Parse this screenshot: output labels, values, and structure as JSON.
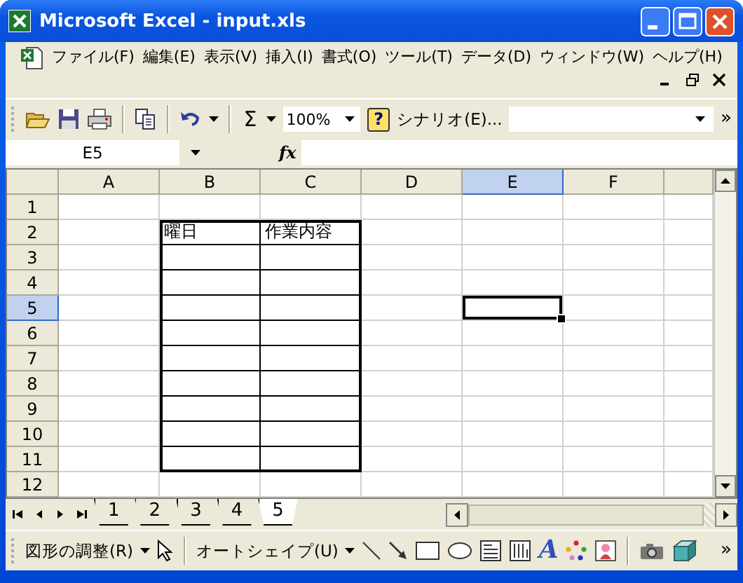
{
  "window": {
    "title": "Microsoft Excel - input.xls"
  },
  "menu": [
    "ファイル(F)",
    "編集(E)",
    "表示(V)",
    "挿入(I)",
    "書式(O)",
    "ツール(T)",
    "データ(D)",
    "ウィンドウ(W)",
    "ヘルプ(H)"
  ],
  "toolbar": {
    "sum": "Σ",
    "zoom": "100%",
    "help_glyph": "?",
    "scenario": "シナリオ(E)...",
    "overflow": "»"
  },
  "formula_bar": {
    "name_box": "E5",
    "fx": "fx"
  },
  "grid": {
    "columns": [
      {
        "label": "A",
        "selected": false
      },
      {
        "label": "B",
        "selected": false
      },
      {
        "label": "C",
        "selected": false
      },
      {
        "label": "D",
        "selected": false
      },
      {
        "label": "E",
        "selected": true
      },
      {
        "label": "F",
        "selected": false
      }
    ],
    "rows": [
      {
        "label": "1",
        "selected": false
      },
      {
        "label": "2",
        "selected": false,
        "cells": [
          {
            "bordered": false,
            "selected": false
          },
          {
            "bordered": true,
            "selected": false,
            "text": "曜日"
          },
          {
            "bordered": true,
            "selected": false,
            "text": "作業内容"
          }
        ]
      },
      {
        "label": "3",
        "selected": false,
        "cells": [
          {
            "bordered": false,
            "selected": false
          },
          {
            "bordered": true,
            "selected": false
          },
          {
            "bordered": true,
            "selected": false
          }
        ]
      },
      {
        "label": "4",
        "selected": false,
        "cells": [
          {
            "bordered": false,
            "selected": false
          },
          {
            "bordered": true,
            "selected": false
          },
          {
            "bordered": true,
            "selected": false
          }
        ]
      },
      {
        "label": "5",
        "selected": true,
        "cells": [
          {
            "bordered": false,
            "selected": false
          },
          {
            "bordered": true,
            "selected": false
          },
          {
            "bordered": true,
            "selected": false
          },
          {
            "bordered": false,
            "selected": false
          },
          {
            "bordered": false,
            "selected": true
          }
        ]
      },
      {
        "label": "6",
        "selected": false,
        "cells": [
          {
            "bordered": false,
            "selected": false
          },
          {
            "bordered": true,
            "selected": false
          },
          {
            "bordered": true,
            "selected": false
          }
        ]
      },
      {
        "label": "7",
        "selected": false,
        "cells": [
          {
            "bordered": false,
            "selected": false
          },
          {
            "bordered": true,
            "selected": false
          },
          {
            "bordered": true,
            "selected": false
          }
        ]
      },
      {
        "label": "8",
        "selected": false,
        "cells": [
          {
            "bordered": false,
            "selected": false
          },
          {
            "bordered": true,
            "selected": false
          },
          {
            "bordered": true,
            "selected": false
          }
        ]
      },
      {
        "label": "9",
        "selected": false,
        "cells": [
          {
            "bordered": false,
            "selected": false
          },
          {
            "bordered": true,
            "selected": false
          },
          {
            "bordered": true,
            "selected": false
          }
        ]
      },
      {
        "label": "10",
        "selected": false,
        "cells": [
          {
            "bordered": false,
            "selected": false
          },
          {
            "bordered": true,
            "selected": false
          },
          {
            "bordered": true,
            "selected": false
          }
        ]
      },
      {
        "label": "11",
        "selected": false,
        "cells": [
          {
            "bordered": false,
            "selected": false
          },
          {
            "bordered": true,
            "selected": false
          },
          {
            "bordered": true,
            "selected": false
          }
        ]
      },
      {
        "label": "12",
        "selected": false
      }
    ]
  },
  "sheet_tabs": [
    {
      "label": "1",
      "selected": false
    },
    {
      "label": "2",
      "selected": false
    },
    {
      "label": "3",
      "selected": false
    },
    {
      "label": "4",
      "selected": false
    },
    {
      "label": "5",
      "selected": true
    }
  ],
  "drawing_toolbar": {
    "draw_menu": "図形の調整(R)",
    "autoshapes": "オートシェイプ(U)",
    "wordart_glyph": "A",
    "overflow": "»"
  }
}
